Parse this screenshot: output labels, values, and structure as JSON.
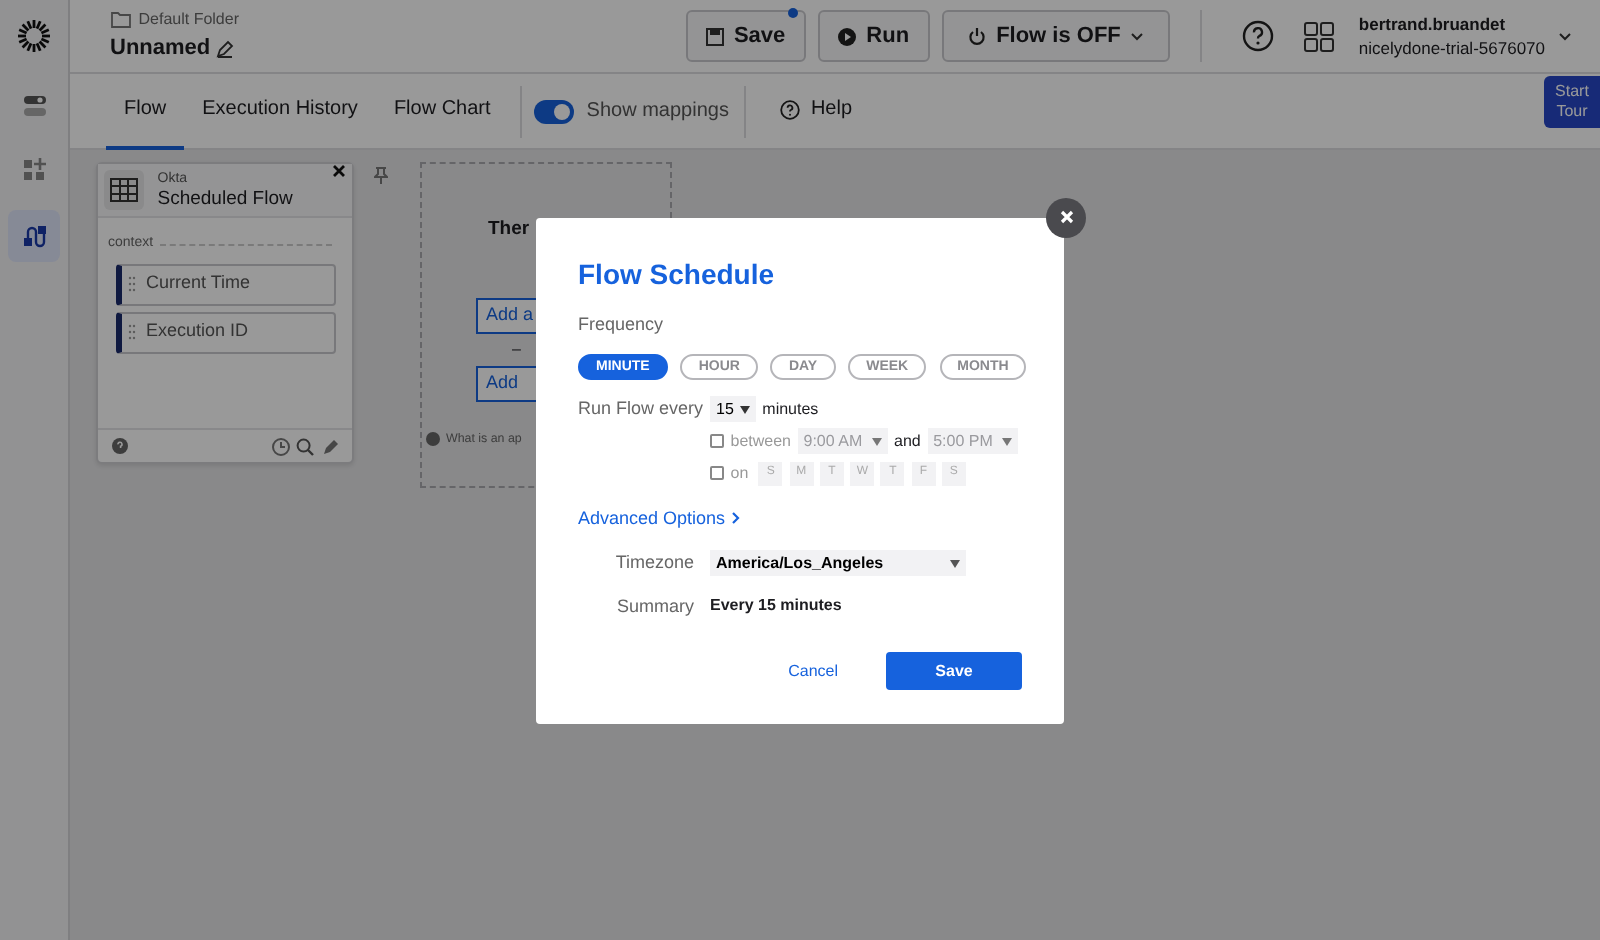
{
  "sidebar": {
    "items": [
      {
        "kind": "toggles",
        "selected": false
      },
      {
        "kind": "apps",
        "selected": false
      },
      {
        "kind": "flows",
        "selected": true
      }
    ]
  },
  "header": {
    "folder": "Default Folder",
    "title": "Unnamed",
    "save": {
      "label": "Save",
      "unsaved": true
    },
    "run": "Run",
    "flow_status": "Flow is OFF",
    "user": "bertrand.bruandet",
    "org": "nicelydone-trial-5676070"
  },
  "tabs": [
    {
      "label": "Flow",
      "selected": true
    },
    {
      "label": "Execution History",
      "selected": false
    },
    {
      "label": "Flow Chart",
      "selected": false
    }
  ],
  "mappings": {
    "label": "Show mappings",
    "on": true
  },
  "help": "Help",
  "start_tour": "Start Tour",
  "event_card": {
    "app": "Okta",
    "title": "Scheduled Flow",
    "section": "context",
    "fields": [
      "Current Time",
      "Execution ID"
    ]
  },
  "action_panel": {
    "heading": "Ther",
    "buttons": [
      "Add a",
      "Add"
    ],
    "separator": "–",
    "hint": "What is an ap"
  },
  "modal": {
    "title": "Flow Schedule",
    "frequency_label": "Frequency",
    "frequencies": [
      {
        "label": "MINUTE",
        "selected": true
      },
      {
        "label": "HOUR",
        "selected": false
      },
      {
        "label": "DAY",
        "selected": false
      },
      {
        "label": "WEEK",
        "selected": false
      },
      {
        "label": "MONTH",
        "selected": false
      }
    ],
    "run_every_label": "Run Flow every",
    "interval": "15",
    "unit": "minutes",
    "between": {
      "checked": false,
      "label": "between",
      "start": "9:00 AM",
      "joiner": "and",
      "end": "5:00 PM"
    },
    "on_days": {
      "checked": false,
      "label": "on",
      "days": [
        "S",
        "M",
        "T",
        "W",
        "T",
        "F",
        "S"
      ]
    },
    "advanced": "Advanced Options",
    "timezone_label": "Timezone",
    "timezone": "America/Los_Angeles",
    "summary_label": "Summary",
    "summary": "Every 15 minutes",
    "cancel": "Cancel",
    "save": "Save"
  }
}
